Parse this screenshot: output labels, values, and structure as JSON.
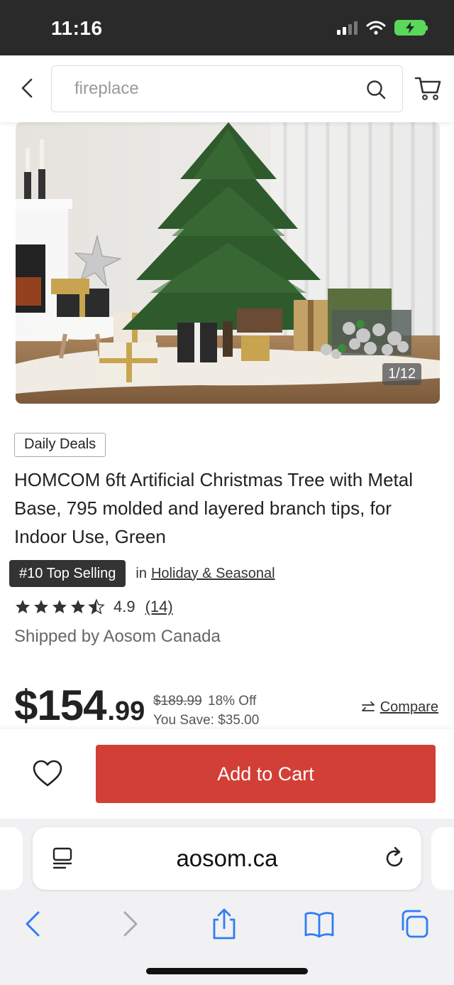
{
  "status_bar": {
    "time": "11:16"
  },
  "header": {
    "search_value": "fireplace",
    "back_icon": "chevron-left-icon",
    "search_icon": "search-icon",
    "cart_icon": "cart-icon"
  },
  "gallery": {
    "counter": "1/12"
  },
  "product": {
    "badge": "Daily Deals",
    "title": "HOMCOM 6ft Artificial Christmas Tree with Metal Base, 795 molded and layered branch tips, for Indoor Use, Green",
    "rank_badge": "#10 Top Selling",
    "rank_in": "in",
    "rank_category": "Holiday & Seasonal",
    "rating": "4.9",
    "rating_stars": 4.5,
    "review_count": "(14)",
    "shipped_by": "Shipped by Aosom Canada"
  },
  "price": {
    "dollars": "$154",
    "cents": ".99",
    "original": "$189.99",
    "off": "18% Off",
    "save": "You Save: $35.00",
    "compare_label": "Compare"
  },
  "actions": {
    "add_to_cart": "Add to Cart",
    "wishlist_icon": "heart-icon"
  },
  "browser": {
    "url": "aosom.ca"
  },
  "colors": {
    "accent": "#d23f37",
    "status_bar": "#2a2a2a",
    "browser_blue": "#2f7cf6"
  }
}
